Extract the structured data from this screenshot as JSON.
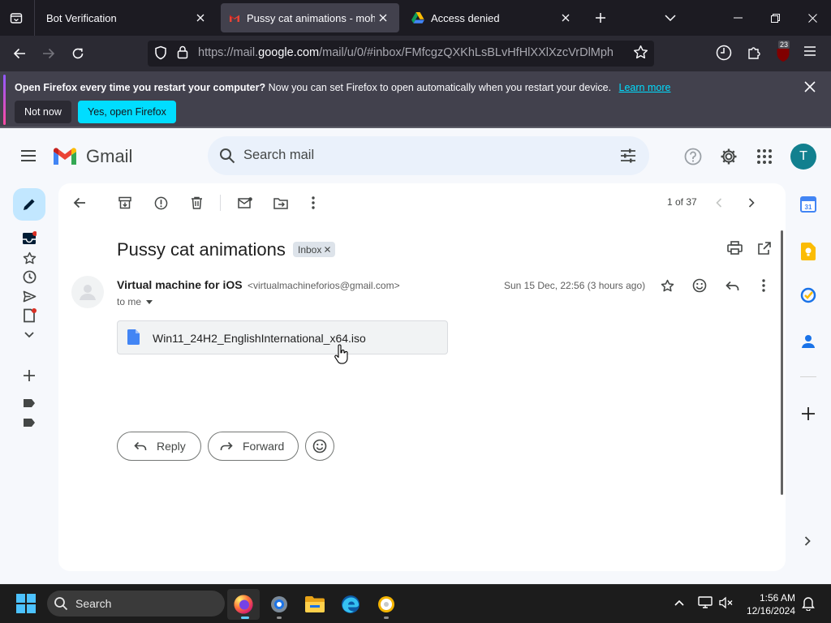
{
  "browser": {
    "tabs": [
      {
        "title": "Bot Verification",
        "active": false
      },
      {
        "title": "Pussy cat animations - mohamm",
        "active": true
      },
      {
        "title": "Access denied",
        "active": false
      }
    ],
    "url_prefix": "https://mail.",
    "url_domain": "google.com",
    "url_suffix": "/mail/u/0/#inbox/FMfcgzQXKhLsBLvHfHlXXlXzcVrDlMph",
    "extension_badge": "23",
    "notification": {
      "bold": "Open Firefox every time you restart your computer?",
      "text": "Now you can set Firefox to open automatically when you restart your device.",
      "link": "Learn more",
      "btn_not_now": "Not now",
      "btn_yes": "Yes, open Firefox"
    }
  },
  "gmail": {
    "logo_text": "Gmail",
    "search_placeholder": "Search mail",
    "avatar_letter": "T",
    "pager": "1 of 37",
    "subject": "Pussy cat animations",
    "label_chip": "Inbox",
    "sender_name": "Virtual machine for iOS",
    "sender_email": "<virtualmachineforios@gmail.com>",
    "to": "to me",
    "date": "Sun 15 Dec, 22:56 (3 hours ago)",
    "attachment_name": "Win11_24H2_EnglishInternational_x64.iso",
    "reply_label": "Reply",
    "forward_label": "Forward"
  },
  "taskbar": {
    "search_label": "Search",
    "time": "1:56 AM",
    "date": "12/16/2024"
  }
}
